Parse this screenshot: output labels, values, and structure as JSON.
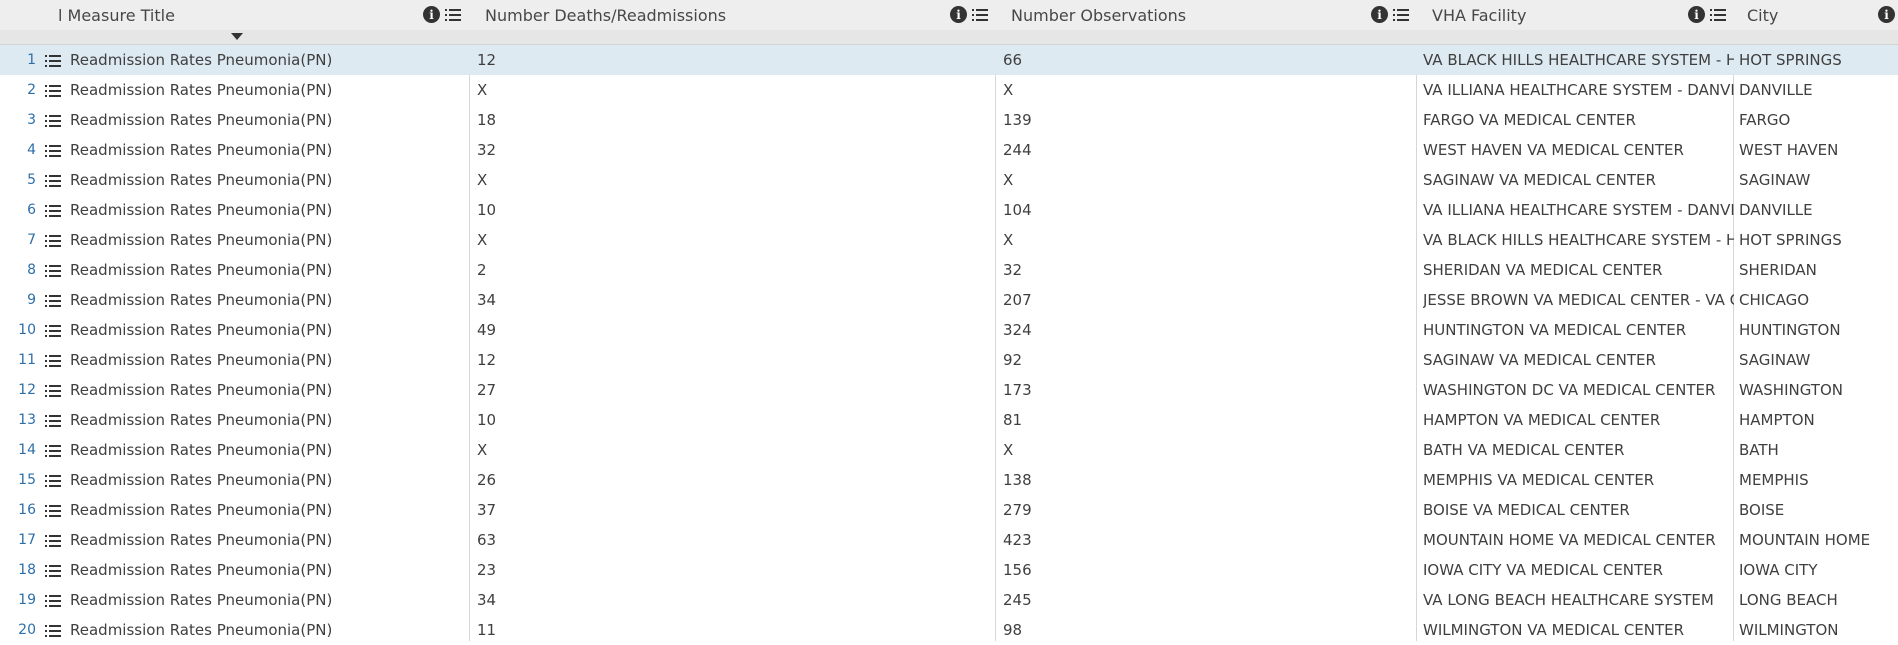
{
  "columns": {
    "measure_title": "l Measure Title",
    "deaths": "Number Deaths/Readmissions",
    "observations": "Number Observations",
    "facility": "VHA Facility",
    "city": "City"
  },
  "rows": [
    {
      "num": "1",
      "measure": "Readmission Rates Pneumonia(PN)",
      "deaths": "12",
      "obs": "66",
      "facility": "VA BLACK HILLS HEALTHCARE SYSTEM - HOT SPRINGS",
      "city": "HOT SPRINGS",
      "selected": true
    },
    {
      "num": "2",
      "measure": "Readmission Rates Pneumonia(PN)",
      "deaths": "X",
      "obs": "X",
      "facility": "VA ILLIANA HEALTHCARE SYSTEM - DANVILLE",
      "city": "DANVILLE"
    },
    {
      "num": "3",
      "measure": "Readmission Rates Pneumonia(PN)",
      "deaths": "18",
      "obs": "139",
      "facility": "FARGO VA MEDICAL CENTER",
      "city": "FARGO"
    },
    {
      "num": "4",
      "measure": "Readmission Rates Pneumonia(PN)",
      "deaths": "32",
      "obs": "244",
      "facility": "WEST HAVEN VA MEDICAL CENTER",
      "city": "WEST HAVEN"
    },
    {
      "num": "5",
      "measure": "Readmission Rates Pneumonia(PN)",
      "deaths": "X",
      "obs": "X",
      "facility": "SAGINAW VA MEDICAL CENTER",
      "city": "SAGINAW"
    },
    {
      "num": "6",
      "measure": "Readmission Rates Pneumonia(PN)",
      "deaths": "10",
      "obs": "104",
      "facility": "VA ILLIANA HEALTHCARE SYSTEM - DANVILLE",
      "city": "DANVILLE"
    },
    {
      "num": "7",
      "measure": "Readmission Rates Pneumonia(PN)",
      "deaths": "X",
      "obs": "X",
      "facility": "VA BLACK HILLS HEALTHCARE SYSTEM - HOT SPRINGS",
      "city": "HOT SPRINGS"
    },
    {
      "num": "8",
      "measure": "Readmission Rates Pneumonia(PN)",
      "deaths": "2",
      "obs": "32",
      "facility": "SHERIDAN VA MEDICAL CENTER",
      "city": "SHERIDAN"
    },
    {
      "num": "9",
      "measure": "Readmission Rates Pneumonia(PN)",
      "deaths": "34",
      "obs": "207",
      "facility": "JESSE BROWN VA MEDICAL CENTER - VA CHICAGO",
      "city": "CHICAGO"
    },
    {
      "num": "10",
      "measure": "Readmission Rates Pneumonia(PN)",
      "deaths": "49",
      "obs": "324",
      "facility": "HUNTINGTON VA MEDICAL CENTER",
      "city": "HUNTINGTON"
    },
    {
      "num": "11",
      "measure": "Readmission Rates Pneumonia(PN)",
      "deaths": "12",
      "obs": "92",
      "facility": "SAGINAW VA MEDICAL CENTER",
      "city": "SAGINAW"
    },
    {
      "num": "12",
      "measure": "Readmission Rates Pneumonia(PN)",
      "deaths": "27",
      "obs": "173",
      "facility": "WASHINGTON DC VA MEDICAL CENTER",
      "city": "WASHINGTON"
    },
    {
      "num": "13",
      "measure": "Readmission Rates Pneumonia(PN)",
      "deaths": "10",
      "obs": "81",
      "facility": "HAMPTON VA MEDICAL CENTER",
      "city": "HAMPTON"
    },
    {
      "num": "14",
      "measure": "Readmission Rates Pneumonia(PN)",
      "deaths": "X",
      "obs": "X",
      "facility": "BATH VA MEDICAL CENTER",
      "city": "BATH"
    },
    {
      "num": "15",
      "measure": "Readmission Rates Pneumonia(PN)",
      "deaths": "26",
      "obs": "138",
      "facility": "MEMPHIS VA MEDICAL CENTER",
      "city": "MEMPHIS"
    },
    {
      "num": "16",
      "measure": "Readmission Rates Pneumonia(PN)",
      "deaths": "37",
      "obs": "279",
      "facility": "BOISE VA MEDICAL CENTER",
      "city": "BOISE"
    },
    {
      "num": "17",
      "measure": "Readmission Rates Pneumonia(PN)",
      "deaths": "63",
      "obs": "423",
      "facility": "MOUNTAIN HOME VA MEDICAL CENTER",
      "city": "MOUNTAIN HOME"
    },
    {
      "num": "18",
      "measure": "Readmission Rates Pneumonia(PN)",
      "deaths": "23",
      "obs": "156",
      "facility": "IOWA CITY VA MEDICAL CENTER",
      "city": "IOWA CITY"
    },
    {
      "num": "19",
      "measure": "Readmission Rates Pneumonia(PN)",
      "deaths": "34",
      "obs": "245",
      "facility": "VA LONG BEACH HEALTHCARE SYSTEM",
      "city": "LONG BEACH"
    },
    {
      "num": "20",
      "measure": "Readmission Rates Pneumonia(PN)",
      "deaths": "11",
      "obs": "98",
      "facility": "WILMINGTON VA MEDICAL CENTER",
      "city": "WILMINGTON"
    }
  ],
  "colors": {
    "header_bg": "#eeeeee",
    "selected_row": "#deeaf1",
    "row_number": "#2f6fa8",
    "gridline": "#d6d6d6"
  },
  "icons": [
    "info-icon",
    "column-menu-icon",
    "sort-descending-icon",
    "row-details-icon"
  ]
}
